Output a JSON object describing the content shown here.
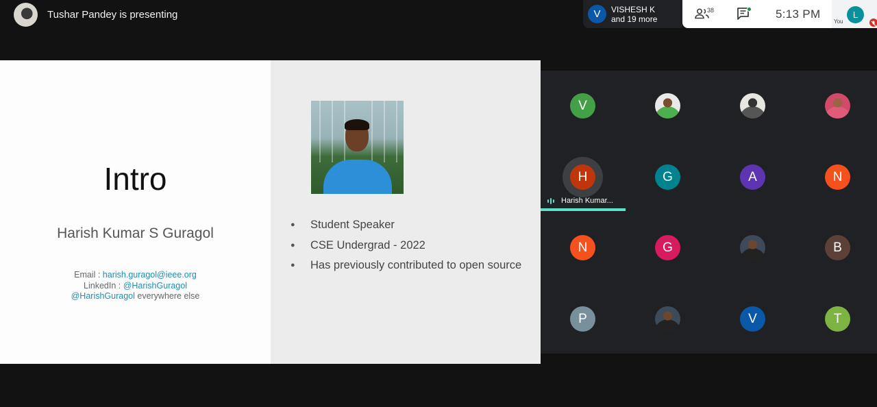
{
  "presenter": {
    "text": "Tushar Pandey is presenting",
    "avatar_icon": "presenter-avatar"
  },
  "join_notice": {
    "avatar_letter": "V",
    "name": "VISHESH K",
    "more": "and 19 more",
    "color": "#0b57a8"
  },
  "toolbar": {
    "people_count": "38",
    "time": "5:13  PM",
    "self_letter": "L",
    "self_label": "You",
    "self_color": "#0a8f9c"
  },
  "slide": {
    "title": "Intro",
    "name": "Harish Kumar S Guragol",
    "contacts": {
      "email_label": "Email : ",
      "email": "harish.guragol@ieee.org",
      "linkedin_label": "LinkedIn : ",
      "linkedin": "@HarishGuragol",
      "handle": "@HarishGuragol",
      "handle_suffix": " everywhere else"
    },
    "bullets": [
      "Student Speaker",
      "CSE Undergrad - 2022",
      "Has previously contributed to open source"
    ]
  },
  "participants": [
    {
      "letter": "V",
      "color": "#43a047"
    },
    {
      "photo": "ph-green"
    },
    {
      "photo": "ph-light"
    },
    {
      "photo": "ph-pink"
    },
    {
      "letter": "H",
      "color": "#bf360c",
      "speaking": true,
      "label": "Harish Kumar..."
    },
    {
      "letter": "G",
      "color": "#00838f"
    },
    {
      "letter": "A",
      "color": "#5e35b1"
    },
    {
      "letter": "N",
      "color": "#f4511e"
    },
    {
      "letter": "N",
      "color": "#f4511e"
    },
    {
      "letter": "G",
      "color": "#d81b60"
    },
    {
      "photo": "ph-dark"
    },
    {
      "letter": "B",
      "color": "#5d4037"
    },
    {
      "letter": "P",
      "color": "#78909c"
    },
    {
      "photo": "ph-dark"
    },
    {
      "letter": "V",
      "color": "#0b57a8"
    },
    {
      "letter": "T",
      "color": "#7cb342"
    }
  ]
}
